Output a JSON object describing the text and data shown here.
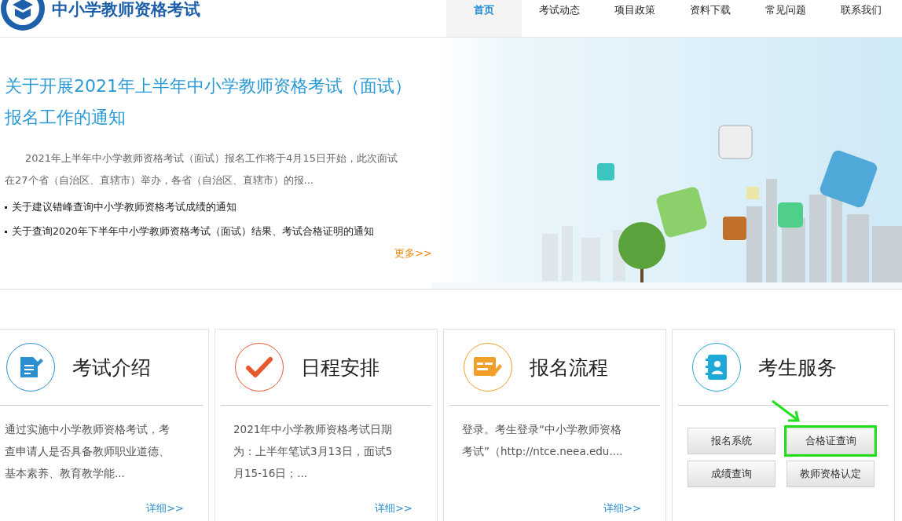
{
  "header": {
    "site_title": "中小学教师资格考试",
    "nav": [
      {
        "label": "首页",
        "selected": true
      },
      {
        "label": "考试动态",
        "selected": false
      },
      {
        "label": "项目政策",
        "selected": false
      },
      {
        "label": "资料下载",
        "selected": false
      },
      {
        "label": "常见问题",
        "selected": false
      },
      {
        "label": "联系我们",
        "selected": false
      }
    ]
  },
  "banner": {
    "headline": "关于开展2021年上半年中小学教师资格考试（面试）报名工作的通知",
    "summary": "2021年上半年中小学教师资格考试（面试）报名工作将于4月15日开始，此次面试在27个省（自治区、直辖市）举办，各省（自治区、直辖市）的报...",
    "links": [
      "关于建议错峰查询中小学教师资格考试成绩的通知",
      "关于查询2020年下半年中小学教师资格考试（面试）结果、考试合格证明的通知"
    ],
    "more": "更多>>"
  },
  "cards": [
    {
      "kind": "text",
      "title": "考试介绍",
      "body": "通过实施中小学教师资格考试，考查申请人是否具备教师职业道德、基本素养、教育教学能...",
      "more": "详细>>"
    },
    {
      "kind": "text",
      "title": "日程安排",
      "body": "2021年中小学教师资格考试日期为：上半年笔试3月13日，面试5月15-16日；...",
      "more": "详细>>"
    },
    {
      "kind": "text",
      "title": "报名流程",
      "body": "登录。考生登录“中小学教师资格考试”（http://ntce.neea.edu....",
      "more": "详细>>"
    },
    {
      "kind": "buttons",
      "title": "考生服务",
      "buttons": [
        {
          "label": "报名系统",
          "highlighted": false
        },
        {
          "label": "合格证查询",
          "highlighted": true
        },
        {
          "label": "成绩查询",
          "highlighted": false
        },
        {
          "label": "教师资格认定",
          "highlighted": false
        }
      ]
    }
  ]
}
